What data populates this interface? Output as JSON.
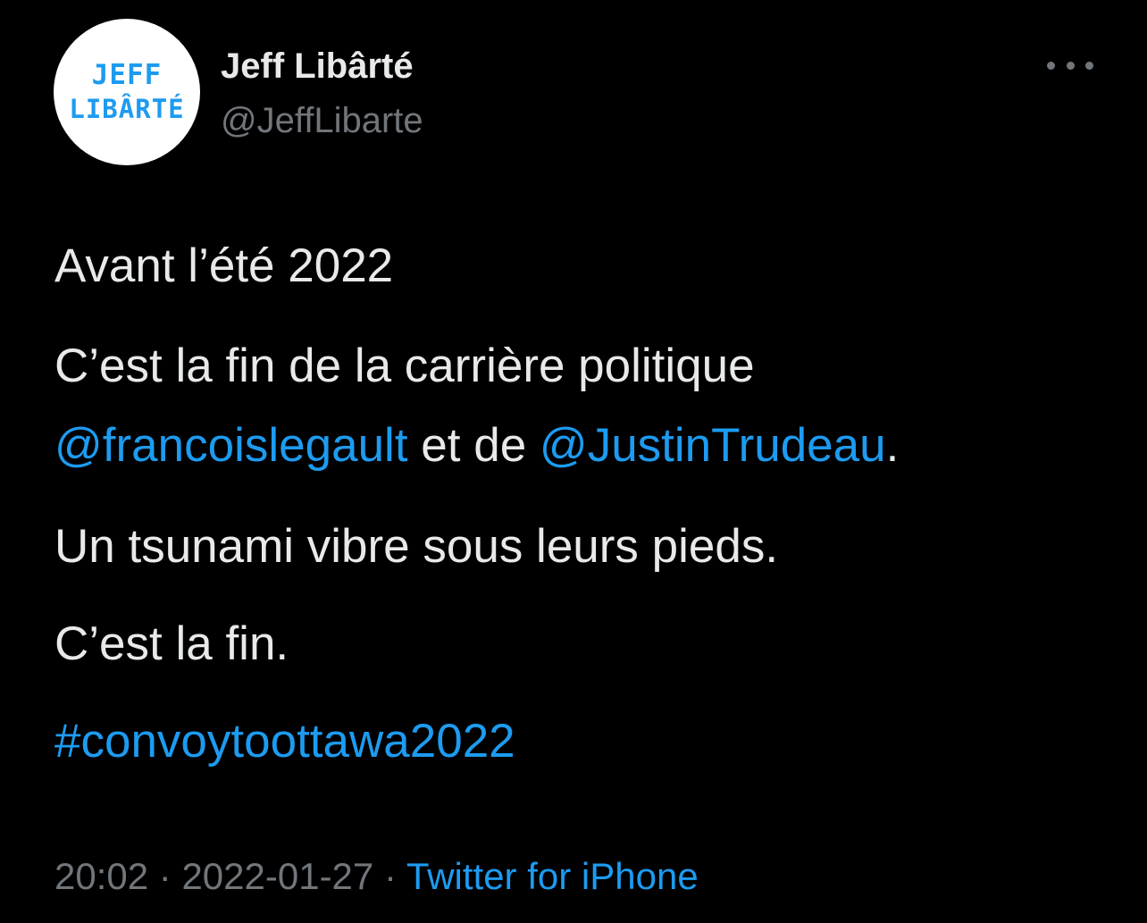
{
  "author": {
    "avatar_line1": "JEFF",
    "avatar_line2": "LIBÂRTÉ",
    "display_name": "Jeff Libârté",
    "handle": "@JeffLibarte"
  },
  "more_icon": "more-horizontal-icon",
  "tweet": {
    "line1": "Avant l’été 2022",
    "line2": "C’est la fin de la carrière politique",
    "mention1": "@francoislegault",
    "line3_middle": " et de ",
    "mention2": "@JustinTrudeau",
    "line3_end": ".",
    "line4": "Un tsunami vibre sous leurs pieds.",
    "line5": "C’est la fin.",
    "hashtag": "#convoytoottawa2022"
  },
  "meta": {
    "time": "20:02",
    "separator1": " · ",
    "date": "2022-01-27",
    "separator2": " · ",
    "source": "Twitter for iPhone"
  },
  "colors": {
    "background": "#000000",
    "text": "#e7e9ea",
    "muted": "#71767b",
    "link": "#1d9bf0"
  }
}
